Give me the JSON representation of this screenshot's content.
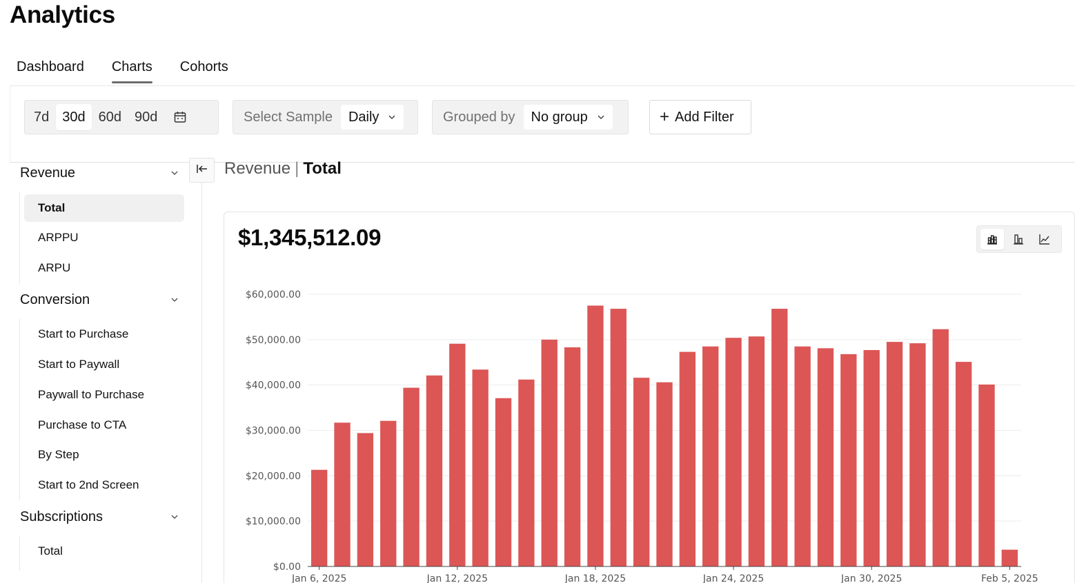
{
  "app": {
    "title": "Analytics"
  },
  "tabs": [
    {
      "label": "Dashboard",
      "active": false
    },
    {
      "label": "Charts",
      "active": true
    },
    {
      "label": "Cohorts",
      "active": false
    }
  ],
  "filters": {
    "ranges": [
      {
        "label": "7d",
        "active": false
      },
      {
        "label": "30d",
        "active": true
      },
      {
        "label": "60d",
        "active": false
      },
      {
        "label": "90d",
        "active": false
      }
    ],
    "calendar_icon": "calendar-icon",
    "sample": {
      "label": "Select Sample",
      "value": "Daily"
    },
    "grouped_by": {
      "label": "Grouped by",
      "value": "No group"
    },
    "add_filter_label": "Add Filter"
  },
  "sidebar": {
    "sections": [
      {
        "label": "Revenue",
        "items": [
          {
            "label": "Total",
            "active": true
          },
          {
            "label": "ARPPU",
            "active": false
          },
          {
            "label": "ARPU",
            "active": false
          }
        ]
      },
      {
        "label": "Conversion",
        "items": [
          {
            "label": "Start to Purchase",
            "active": false
          },
          {
            "label": "Start to Paywall",
            "active": false
          },
          {
            "label": "Paywall to Purchase",
            "active": false
          },
          {
            "label": "Purchase to CTA",
            "active": false
          },
          {
            "label": "By Step",
            "active": false
          },
          {
            "label": "Start to 2nd Screen",
            "active": false
          }
        ]
      },
      {
        "label": "Subscriptions",
        "items": [
          {
            "label": "Total",
            "active": false
          }
        ]
      }
    ]
  },
  "breadcrumb": {
    "parent": "Revenue",
    "separator": "|",
    "current": "Total"
  },
  "summary": {
    "total": "$1,345,512.09"
  },
  "viz_toggle": [
    {
      "icon": "stacked-bar-chart-icon",
      "active": true
    },
    {
      "icon": "bar-chart-icon",
      "active": false
    },
    {
      "icon": "line-chart-icon",
      "active": false
    }
  ],
  "colors": {
    "bar": "#dc5656",
    "grid": "#ececec",
    "axis": "#444444"
  },
  "chart_data": {
    "type": "bar",
    "x": [
      "Jan 6, 2025",
      "Jan 7, 2025",
      "Jan 8, 2025",
      "Jan 9, 2025",
      "Jan 10, 2025",
      "Jan 11, 2025",
      "Jan 12, 2025",
      "Jan 13, 2025",
      "Jan 14, 2025",
      "Jan 15, 2025",
      "Jan 16, 2025",
      "Jan 17, 2025",
      "Jan 18, 2025",
      "Jan 19, 2025",
      "Jan 20, 2025",
      "Jan 21, 2025",
      "Jan 22, 2025",
      "Jan 23, 2025",
      "Jan 24, 2025",
      "Jan 25, 2025",
      "Jan 26, 2025",
      "Jan 27, 2025",
      "Jan 28, 2025",
      "Jan 29, 2025",
      "Jan 30, 2025",
      "Jan 31, 2025",
      "Feb 1, 2025",
      "Feb 2, 2025",
      "Feb 3, 2025",
      "Feb 4, 2025",
      "Feb 5, 2025"
    ],
    "values": [
      21300,
      31700,
      29400,
      32100,
      39400,
      42100,
      49100,
      43400,
      37100,
      41200,
      50000,
      48300,
      57500,
      56800,
      41600,
      40600,
      47300,
      48500,
      50400,
      50700,
      56800,
      48500,
      48100,
      46800,
      47700,
      49500,
      49200,
      52300,
      45100,
      40100,
      3700
    ],
    "x_tick_labels": [
      "Jan 6, 2025",
      "Jan 12, 2025",
      "Jan 18, 2025",
      "Jan 24, 2025",
      "Jan 30, 2025",
      "Feb 5, 2025"
    ],
    "y_tick_labels": [
      "$0.00",
      "$10,000.00",
      "$20,000.00",
      "$30,000.00",
      "$40,000.00",
      "$50,000.00",
      "$60,000.00"
    ],
    "ylim": [
      0,
      60000
    ],
    "grid": true,
    "legend": "none"
  }
}
